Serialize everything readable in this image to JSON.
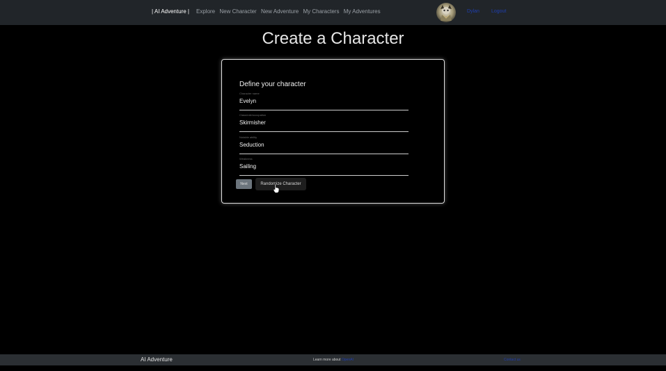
{
  "navbar": {
    "brand": "| AI Adventure |",
    "links": [
      "Explore",
      "New Character",
      "New Adventure",
      "My Characters",
      "My Adventures"
    ],
    "user": "Dylan",
    "logout": "Logout"
  },
  "page": {
    "title": "Create a Character"
  },
  "form": {
    "heading": "Define your character",
    "fields": [
      {
        "label": "Character name",
        "value": "Evelyn"
      },
      {
        "label": "Class/role/occupation",
        "value": "Skirmisher"
      },
      {
        "label": "Notable ability",
        "value": "Seduction"
      },
      {
        "label": "Weakness",
        "value": "Sailing"
      }
    ],
    "next_label": "Next",
    "randomize_label": "Randomize Character"
  },
  "footer": {
    "brand": "AI Adventure",
    "learn_text": "Learn more about",
    "learn_link": "OpenAI",
    "right_link": "Contact us"
  }
}
